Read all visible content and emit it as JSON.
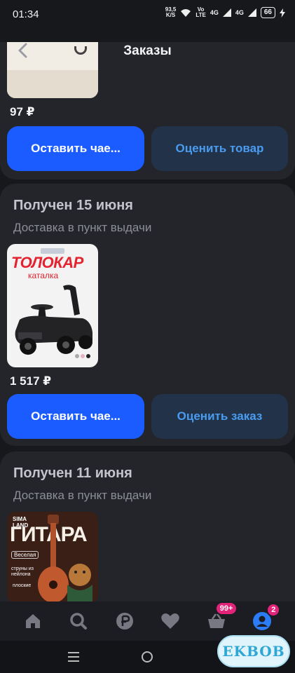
{
  "status_bar": {
    "time": "01:34",
    "speed": "93,5",
    "speed_unit": "K/S",
    "volte_top": "Vo",
    "volte_bottom": "LTE",
    "network1": "4G",
    "network2": "4G",
    "battery": "66"
  },
  "header": {
    "title": "Заказы"
  },
  "orders": [
    {
      "price": "97 ₽",
      "primary_label": "Оставить чае...",
      "secondary_label": "Оценить товар"
    },
    {
      "status": "Получен 15 июня",
      "delivery": "Доставка в пункт выдачи",
      "product_title": "ТОЛОКАР",
      "product_subtitle": "каталка",
      "price": "1 517 ₽",
      "primary_label": "Оставить чае...",
      "secondary_label": "Оценить заказ"
    },
    {
      "status": "Получен 11 июня",
      "delivery": "Доставка в пункт выдачи",
      "product_brand_top": "SIMA",
      "product_brand_bottom": "LAND",
      "product_title": "ГИТАРА",
      "product_tag": "Веселая",
      "product_note": "струны из нейлона",
      "product_note2": "плоские"
    }
  ],
  "bottom_nav": {
    "items": [
      "home-icon",
      "search-icon",
      "ruble-icon",
      "heart-icon",
      "basket-icon",
      "profile-icon"
    ],
    "cart_badge": "99+",
    "profile_badge": "2"
  },
  "watermark": "EKBOB",
  "colors": {
    "background": "#17181c",
    "card": "#24252b",
    "primary": "#1a5cff",
    "secondary_bg": "#213249",
    "secondary_text": "#4a9cf0",
    "badge": "#e2237a"
  }
}
